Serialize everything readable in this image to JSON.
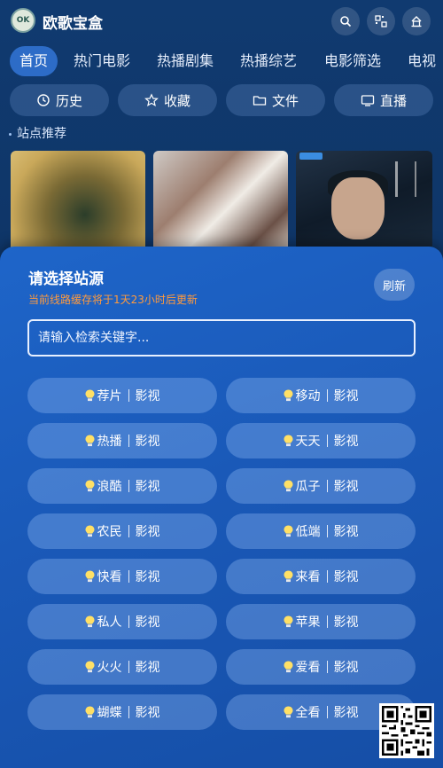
{
  "app": {
    "title": "欧歌宝盒",
    "logo_text": "OK"
  },
  "top_buttons": [
    {
      "icon": "search-icon"
    },
    {
      "icon": "qr-scan-icon"
    },
    {
      "icon": "home-icon"
    }
  ],
  "tabs": [
    "首页",
    "热门电影",
    "热播剧集",
    "热播综艺",
    "电影筛选",
    "电视"
  ],
  "quick_actions": [
    {
      "label": "历史",
      "icon": "history-icon"
    },
    {
      "label": "收藏",
      "icon": "star-icon"
    },
    {
      "label": "文件",
      "icon": "folder-icon"
    },
    {
      "label": "直播",
      "icon": "tv-icon"
    }
  ],
  "section_label": "站点推荐",
  "sheet": {
    "title": "请选择站源",
    "subtitle": "当前线路缓存将于1天23小时后更新",
    "refresh_label": "刷新",
    "search_placeholder": "请输入检索关键字...",
    "sites": [
      {
        "name": "荐片",
        "type": "影视"
      },
      {
        "name": "移动",
        "type": "影视"
      },
      {
        "name": "热播",
        "type": "影视"
      },
      {
        "name": "天天",
        "type": "影视"
      },
      {
        "name": "浪酷",
        "type": "影视"
      },
      {
        "name": "瓜子",
        "type": "影视"
      },
      {
        "name": "农民",
        "type": "影视"
      },
      {
        "name": "低端",
        "type": "影视"
      },
      {
        "name": "快看",
        "type": "影视"
      },
      {
        "name": "来看",
        "type": "影视"
      },
      {
        "name": "私人",
        "type": "影视"
      },
      {
        "name": "苹果",
        "type": "影视"
      },
      {
        "name": "火火",
        "type": "影视"
      },
      {
        "name": "爱看",
        "type": "影视"
      },
      {
        "name": "蝴蝶",
        "type": "影视"
      },
      {
        "name": "全看",
        "type": "影视"
      }
    ]
  },
  "colors": {
    "accent_tab": "#2d6cc7",
    "subtitle": "#ff9a3d",
    "bulb": "#ffe066"
  }
}
